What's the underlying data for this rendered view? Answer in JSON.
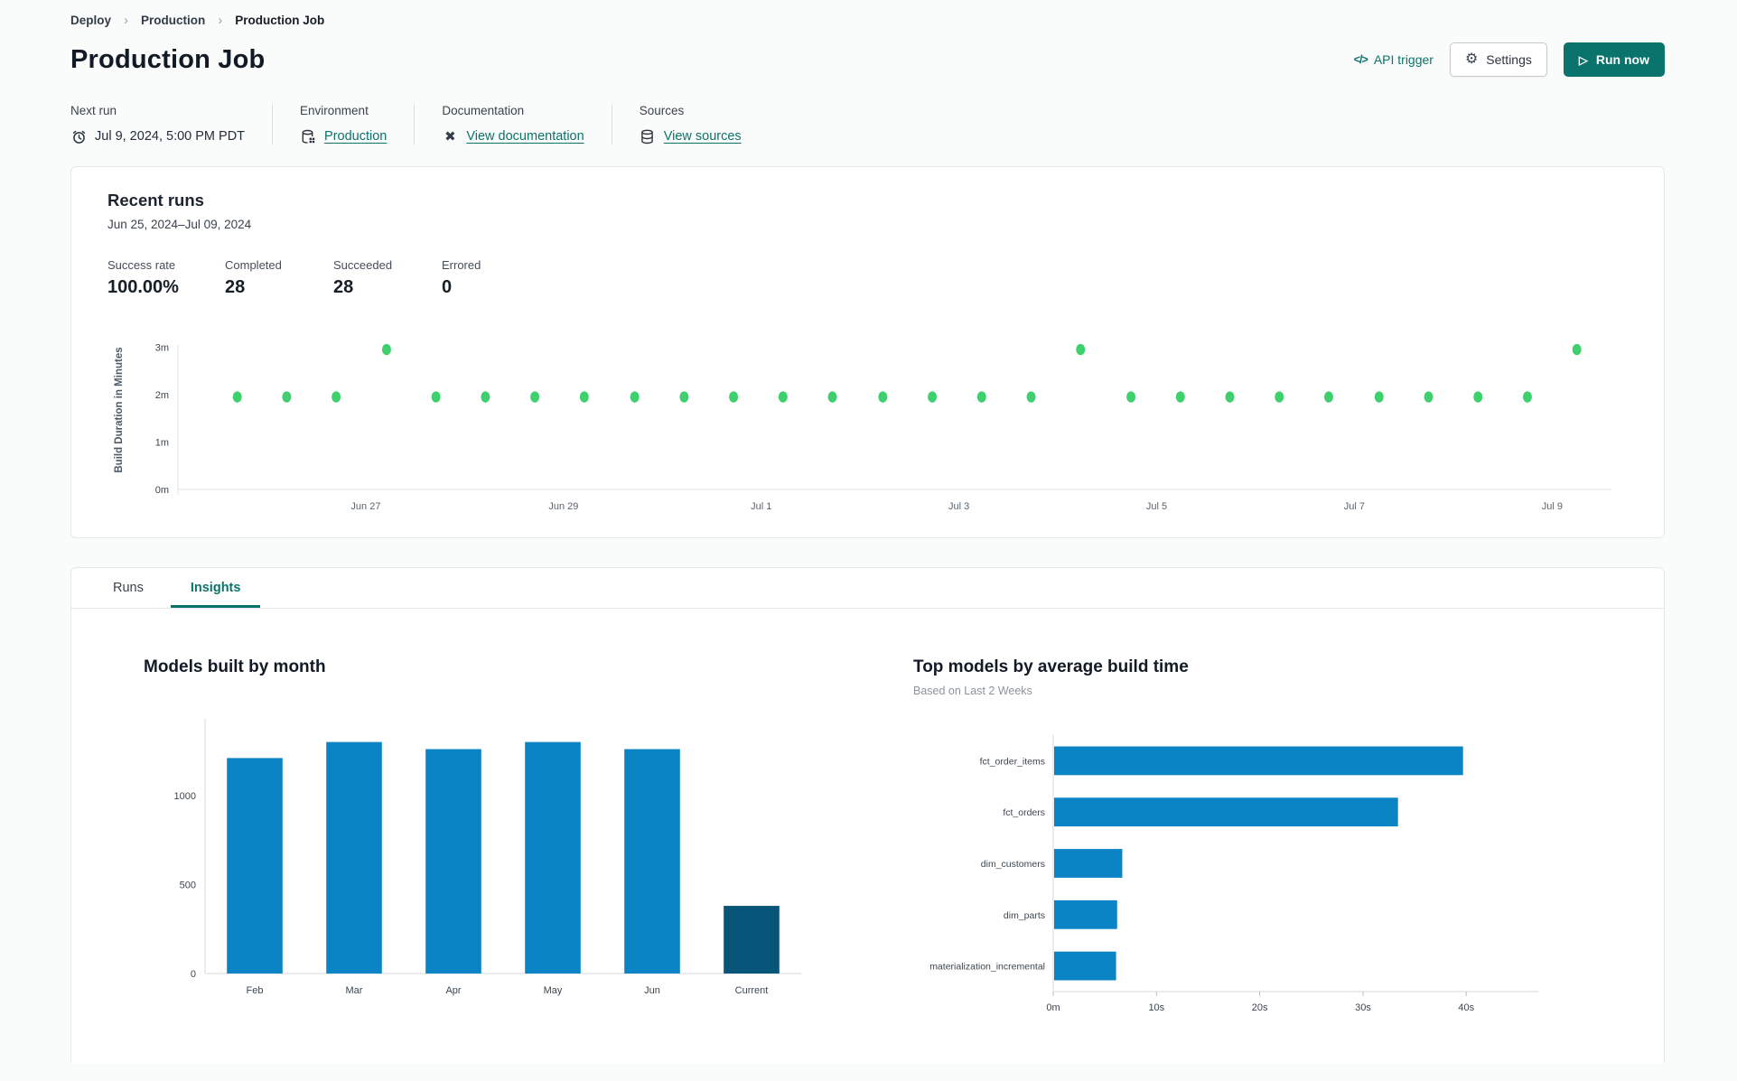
{
  "breadcrumb": {
    "items": [
      "Deploy",
      "Production",
      "Production Job"
    ]
  },
  "header": {
    "title": "Production Job",
    "api_trigger": {
      "icon": "</>",
      "label": "API trigger"
    },
    "settings_label": "Settings",
    "run_now_label": "Run now",
    "play_glyph": "▷",
    "gear_glyph": "⚙"
  },
  "meta": {
    "next_run": {
      "label": "Next run",
      "value": "Jul 9, 2024, 5:00 PM PDT"
    },
    "environment": {
      "label": "Environment",
      "value": "Production"
    },
    "documentation": {
      "label": "Documentation",
      "value": "View documentation"
    },
    "sources": {
      "label": "Sources",
      "value": "View sources"
    }
  },
  "recent_runs": {
    "title": "Recent runs",
    "date_range": "Jun 25, 2024–Jul 09, 2024",
    "stats": [
      {
        "label": "Success rate",
        "value": "100.00%"
      },
      {
        "label": "Completed",
        "value": "28"
      },
      {
        "label": "Succeeded",
        "value": "28"
      },
      {
        "label": "Errored",
        "value": "0"
      }
    ]
  },
  "tabs": [
    {
      "label": "Runs",
      "active": false
    },
    {
      "label": "Insights",
      "active": true
    }
  ],
  "insights": {
    "models_by_month_title": "Models built by month",
    "top_models_title": "Top models by average build time",
    "top_models_subtitle": "Based on Last 2 Weeks"
  },
  "colors": {
    "accent_teal": "#0a736c",
    "dot_green": "#3ecf6e",
    "bar_blue": "#0a84c5",
    "bar_dark": "#08557a",
    "axis_line": "#dde1e4",
    "axis_text": "#5a6470"
  },
  "chart_data": [
    {
      "id": "build-duration-scatter",
      "type": "scatter",
      "title": "Recent runs build duration",
      "ylabel": "Build Duration in Minutes",
      "point_color": "#3ecf6e",
      "ylim": [
        0,
        3.35
      ],
      "x_domain_days": [
        0.1,
        14.6
      ],
      "y_ticks": [
        {
          "value": 0,
          "label": "0m"
        },
        {
          "value": 1,
          "label": "1m"
        },
        {
          "value": 2,
          "label": "2m"
        },
        {
          "value": 3,
          "label": "3m"
        }
      ],
      "x_ticks": [
        {
          "day": 2,
          "label": "Jun 27"
        },
        {
          "day": 4,
          "label": "Jun 29"
        },
        {
          "day": 6,
          "label": "Jul 1"
        },
        {
          "day": 8,
          "label": "Jul 3"
        },
        {
          "day": 10,
          "label": "Jul 5"
        },
        {
          "day": 12,
          "label": "Jul 7"
        },
        {
          "day": 14,
          "label": "Jul 9"
        }
      ],
      "points": [
        {
          "day": 0.7,
          "minutes": 1.95
        },
        {
          "day": 1.2,
          "minutes": 1.95
        },
        {
          "day": 1.7,
          "minutes": 1.95
        },
        {
          "day": 2.21,
          "minutes": 2.95
        },
        {
          "day": 2.71,
          "minutes": 1.95
        },
        {
          "day": 3.21,
          "minutes": 1.95
        },
        {
          "day": 3.71,
          "minutes": 1.95
        },
        {
          "day": 4.21,
          "minutes": 1.95
        },
        {
          "day": 4.72,
          "minutes": 1.95
        },
        {
          "day": 5.22,
          "minutes": 1.95
        },
        {
          "day": 5.72,
          "minutes": 1.95
        },
        {
          "day": 6.22,
          "minutes": 1.95
        },
        {
          "day": 6.72,
          "minutes": 1.95
        },
        {
          "day": 7.23,
          "minutes": 1.95
        },
        {
          "day": 7.73,
          "minutes": 1.95
        },
        {
          "day": 8.23,
          "minutes": 1.95
        },
        {
          "day": 8.73,
          "minutes": 1.95
        },
        {
          "day": 9.23,
          "minutes": 2.95
        },
        {
          "day": 9.74,
          "minutes": 1.95
        },
        {
          "day": 10.24,
          "minutes": 1.95
        },
        {
          "day": 10.74,
          "minutes": 1.95
        },
        {
          "day": 11.24,
          "minutes": 1.95
        },
        {
          "day": 11.74,
          "minutes": 1.95
        },
        {
          "day": 12.25,
          "minutes": 1.95
        },
        {
          "day": 12.75,
          "minutes": 1.95
        },
        {
          "day": 13.25,
          "minutes": 1.95
        },
        {
          "day": 13.75,
          "minutes": 1.95
        },
        {
          "day": 14.25,
          "minutes": 2.95
        }
      ]
    },
    {
      "id": "models-by-month",
      "type": "bar",
      "title": "Models built by month",
      "categories": [
        "Feb",
        "Mar",
        "Apr",
        "May",
        "Jun",
        "Current"
      ],
      "values": [
        1210,
        1300,
        1260,
        1300,
        1260,
        380
      ],
      "bar_colors": [
        "#0a84c5",
        "#0a84c5",
        "#0a84c5",
        "#0a84c5",
        "#0a84c5",
        "#08557a"
      ],
      "ylim": [
        0,
        1430
      ],
      "y_ticks": [
        {
          "value": 0,
          "label": "0"
        },
        {
          "value": 500,
          "label": "500"
        },
        {
          "value": 1000,
          "label": "1000"
        }
      ]
    },
    {
      "id": "top-models-build-time",
      "type": "hbar",
      "title": "Top models by average build time",
      "subtitle": "Based on Last 2 Weeks",
      "categories": [
        "fct_order_items",
        "fct_orders",
        "dim_customers",
        "dim_parts",
        "materialization_incremental"
      ],
      "values_seconds": [
        39.6,
        33.3,
        6.6,
        6.1,
        6.0
      ],
      "bar_color": "#0a84c5",
      "xlim": [
        0,
        44
      ],
      "x_ticks": [
        {
          "value": 0,
          "label": "0m"
        },
        {
          "value": 10,
          "label": "10s"
        },
        {
          "value": 20,
          "label": "20s"
        },
        {
          "value": 30,
          "label": "30s"
        },
        {
          "value": 40,
          "label": "40s"
        }
      ]
    }
  ]
}
